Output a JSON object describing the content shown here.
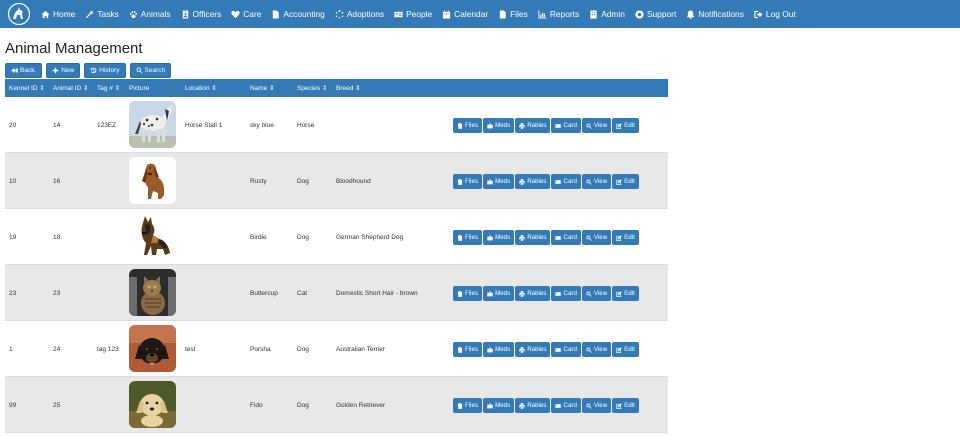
{
  "nav": {
    "items": [
      {
        "label": "Home",
        "icon": "home-icon"
      },
      {
        "label": "Tasks",
        "icon": "wrench-icon"
      },
      {
        "label": "Animals",
        "icon": "paw-icon"
      },
      {
        "label": "Officers",
        "icon": "id-badge-icon"
      },
      {
        "label": "Care",
        "icon": "heart-icon"
      },
      {
        "label": "Accounting",
        "icon": "file-icon"
      },
      {
        "label": "Adoptions",
        "icon": "spinner-icon"
      },
      {
        "label": "People",
        "icon": "id-card-icon"
      },
      {
        "label": "Calendar",
        "icon": "calendar-icon"
      },
      {
        "label": "Files",
        "icon": "file-icon"
      },
      {
        "label": "Reports",
        "icon": "chart-icon"
      },
      {
        "label": "Admin",
        "icon": "building-icon"
      },
      {
        "label": "Support",
        "icon": "lifebuoy-icon"
      },
      {
        "label": "Notifications",
        "icon": "bell-icon"
      },
      {
        "label": "Log Out",
        "icon": "sign-out-icon"
      }
    ]
  },
  "page": {
    "title": "Animal Management"
  },
  "toolbar": {
    "back": "Back.",
    "new": "New",
    "history": "History",
    "search": "Search"
  },
  "table": {
    "headers": {
      "kennel": "Kennel ID",
      "animal": "Animal ID",
      "tag": "Tag #",
      "picture": "Picture",
      "location": "Location",
      "name": "Name",
      "species": "Species",
      "breed": "Breed"
    },
    "actions": {
      "files": "Files",
      "meds": "Meds",
      "rabies": "Rabies",
      "card": "Card",
      "view": "View",
      "edit": "Edit"
    },
    "rows": [
      {
        "kennel": "20",
        "animal": "14",
        "tag": "123EZ",
        "location": "Horse Stall 1",
        "name": "sky blue",
        "species": "Horse",
        "breed": "",
        "photo": "appaloosa-horse"
      },
      {
        "kennel": "10",
        "animal": "16",
        "tag": "",
        "location": "",
        "name": "Rusty",
        "species": "Dog",
        "breed": "Bloodhound",
        "photo": "bloodhound"
      },
      {
        "kennel": "19",
        "animal": "18",
        "tag": "",
        "location": "",
        "name": "Birdie",
        "species": "Dog",
        "breed": "German Shepherd Dog",
        "photo": "german-shepherd"
      },
      {
        "kennel": "23",
        "animal": "23",
        "tag": "",
        "location": "",
        "name": "Buttercup",
        "species": "Cat",
        "breed": "Domestic Short Hair - brown",
        "photo": "tabby-cat"
      },
      {
        "kennel": "1",
        "animal": "24",
        "tag": "tag 123",
        "location": "test",
        "name": "Porsha",
        "species": "Dog",
        "breed": "Australian Terrier",
        "photo": "black-puppy"
      },
      {
        "kennel": "99",
        "animal": "25",
        "tag": "",
        "location": "",
        "name": "Fido",
        "species": "Dog",
        "breed": "Golden Retriever",
        "photo": "golden-puppy"
      }
    ]
  },
  "colors": {
    "primary": "#337ab7",
    "row_alt": "#e8e8e8"
  }
}
